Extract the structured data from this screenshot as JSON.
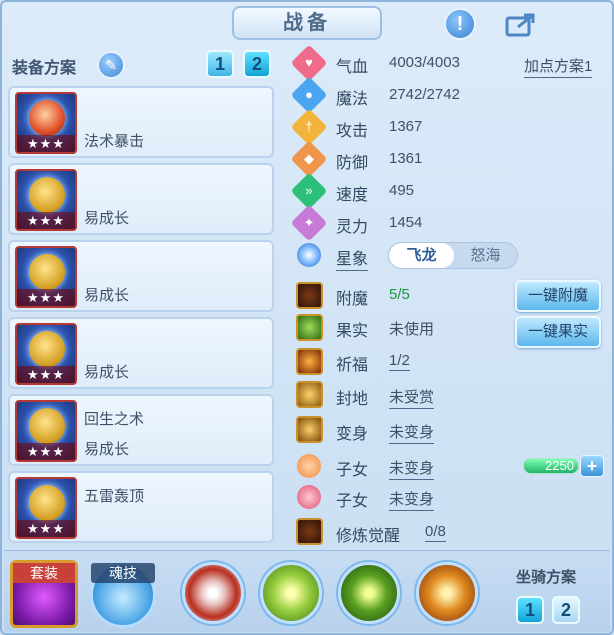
{
  "title": "战备",
  "header_icons": [
    "info-icon",
    "share-icon"
  ],
  "equipment": {
    "title": "装备方案",
    "plans": [
      "1",
      "2"
    ],
    "active_plan": "2",
    "items": [
      {
        "label": "法术暴击",
        "stars": "★★★",
        "icon": "fan-weapon-icon"
      },
      {
        "label": "易成长",
        "stars": "★★★",
        "icon": "helmet-icon"
      },
      {
        "label": "易成长",
        "stars": "★★★",
        "icon": "armor-icon"
      },
      {
        "label": "易成长",
        "stars": "★★★",
        "icon": "necklace-icon"
      },
      {
        "label": "回生之术",
        "label2": "易成长",
        "stars": "★★★",
        "icon": "belt-icon"
      },
      {
        "label": "五雷轰顶",
        "stars": "★★★",
        "icon": "boots-icon"
      }
    ]
  },
  "stats": {
    "add_plan": "加点方案1",
    "rows": [
      {
        "label": "气血",
        "value": "4003/4003",
        "color": "#f06a8a",
        "icon": "heart-icon"
      },
      {
        "label": "魔法",
        "value": "2742/2742",
        "color": "#4aa6f0",
        "icon": "magic-icon"
      },
      {
        "label": "攻击",
        "value": "1367",
        "color": "#f2b43a",
        "icon": "sword-icon"
      },
      {
        "label": "防御",
        "value": "1361",
        "color": "#f0954a",
        "icon": "shield-icon"
      },
      {
        "label": "速度",
        "value": "495",
        "color": "#2cc07a",
        "icon": "speed-icon"
      },
      {
        "label": "灵力",
        "value": "1454",
        "color": "#c77ad8",
        "icon": "spirit-icon"
      }
    ]
  },
  "star_sign": {
    "label": "星象",
    "options": [
      "飞龙",
      "怒海"
    ],
    "selected": "飞龙"
  },
  "attributes": {
    "enchant": {
      "label": "附魔",
      "value": "5/5",
      "button": "一键附魔"
    },
    "fruit": {
      "label": "果实",
      "value": "未使用",
      "button": "一键果实"
    },
    "blessing": {
      "label": "祈福",
      "value": "1/2"
    },
    "fief": {
      "label": "封地",
      "value": "未受赏"
    },
    "transform": {
      "label": "变身",
      "value": "未变身"
    },
    "child1": {
      "label": "子女",
      "value": "未变身",
      "points": "2250",
      "points_fill": 1.0
    },
    "child2": {
      "label": "子女",
      "value": "未变身"
    },
    "cultivation": {
      "label": "修炼觉醒",
      "value": "0/8"
    }
  },
  "bottom": {
    "set_label": "套装",
    "soul_label": "魂技",
    "mount": {
      "title": "坐骑方案",
      "plans": [
        "1",
        "2"
      ],
      "active_plan": "1"
    }
  }
}
